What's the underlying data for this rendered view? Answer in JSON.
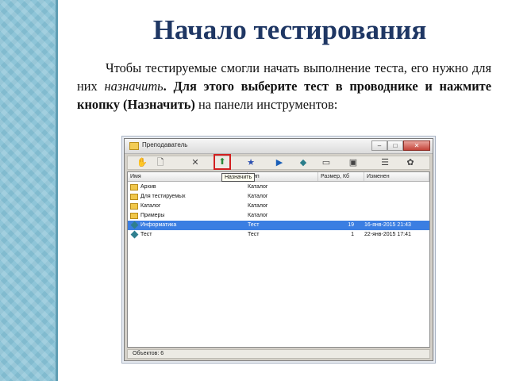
{
  "slide": {
    "title": "Начало тестирования",
    "para_1": "Чтобы тестируемые смогли начать выполнение теста, его нужно для них ",
    "para_em": "назначить",
    "para_2": ". Для этого выберите тест в проводнике и нажмите кнопку ",
    "para_btn": "(Назначить)",
    "para_3": " на панели инструментов:"
  },
  "window": {
    "title": "Преподаватель",
    "btn_min": "–",
    "btn_max": "□",
    "btn_close": "✕",
    "tooltip": "Назначить",
    "toolbar": [
      {
        "icon": "thumb-icon",
        "glyph": "✋"
      },
      {
        "icon": "new-document-icon",
        "glyph": "🗋"
      },
      {
        "icon": "delete-icon",
        "glyph": "✕"
      },
      {
        "icon": "assign-icon",
        "glyph": "⬆"
      },
      {
        "icon": "star-icon",
        "glyph": "★"
      },
      {
        "icon": "play-icon",
        "glyph": "▶"
      },
      {
        "icon": "globe-icon",
        "glyph": "◆"
      },
      {
        "icon": "image-icon",
        "glyph": "▭"
      },
      {
        "icon": "printer-icon",
        "glyph": "▣"
      },
      {
        "icon": "report-icon",
        "glyph": "☰"
      },
      {
        "icon": "settings-icon",
        "glyph": "✿"
      }
    ],
    "columns": {
      "name": "Имя",
      "type": "Тип",
      "size": "Размер, Кб",
      "modified": "Изменен"
    },
    "rows": [
      {
        "name": "Архив",
        "type": "Каталог",
        "size": "",
        "date": "",
        "kind": "folder",
        "selected": false
      },
      {
        "name": "Для тестируемых",
        "type": "Каталог",
        "size": "",
        "date": "",
        "kind": "folder",
        "selected": false
      },
      {
        "name": "Каталог",
        "type": "Каталог",
        "size": "",
        "date": "",
        "kind": "folder",
        "selected": false
      },
      {
        "name": "Примеры",
        "type": "Каталог",
        "size": "",
        "date": "",
        "kind": "folder",
        "selected": false
      },
      {
        "name": "Информатика",
        "type": "Тест",
        "size": "19",
        "date": "16-янв-2015 21:43",
        "kind": "test",
        "selected": true
      },
      {
        "name": "Тест",
        "type": "Тест",
        "size": "1",
        "date": "22-янв-2015 17:41",
        "kind": "test",
        "selected": false
      }
    ],
    "status": "Объектов: 6"
  }
}
